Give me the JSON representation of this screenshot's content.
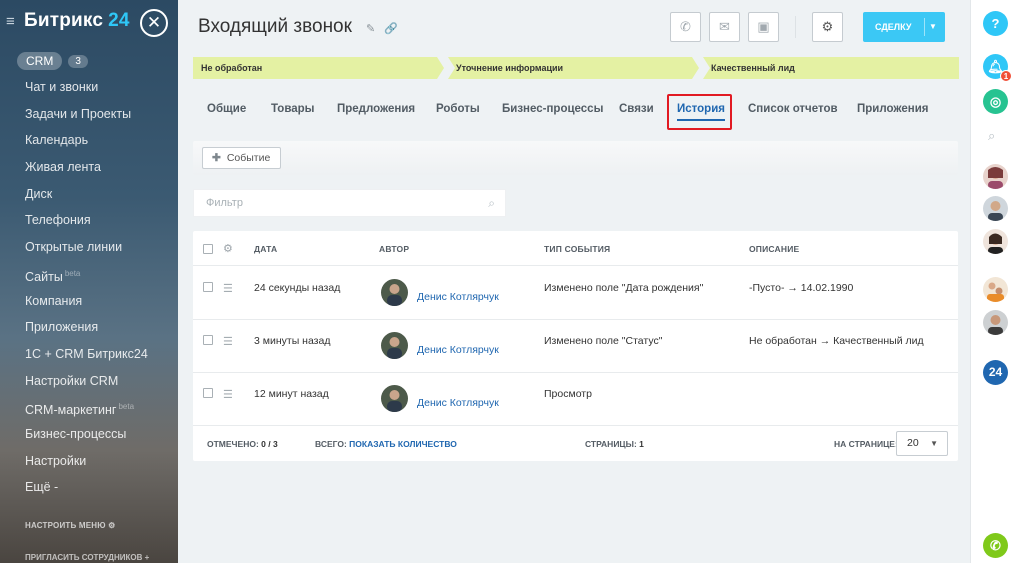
{
  "sidebar": {
    "logo_text": "Битрикс",
    "logo_num": "24",
    "crm_label": "CRM",
    "crm_count": "3",
    "items": [
      {
        "label": "Чат и звонки",
        "beta": ""
      },
      {
        "label": "Задачи и Проекты",
        "beta": ""
      },
      {
        "label": "Календарь",
        "beta": ""
      },
      {
        "label": "Живая лента",
        "beta": ""
      },
      {
        "label": "Диск",
        "beta": ""
      },
      {
        "label": "Телефония",
        "beta": ""
      },
      {
        "label": "Открытые линии",
        "beta": ""
      },
      {
        "label": "Сайты",
        "beta": "beta"
      },
      {
        "label": "Компания",
        "beta": ""
      },
      {
        "label": "Приложения",
        "beta": ""
      },
      {
        "label": "1С + CRM Битрикс24",
        "beta": ""
      },
      {
        "label": "Настройки CRM",
        "beta": ""
      },
      {
        "label": "CRM-маркетинг",
        "beta": "beta"
      },
      {
        "label": "Бизнес-процессы",
        "beta": ""
      },
      {
        "label": "Настройки",
        "beta": ""
      },
      {
        "label": "Ещё -",
        "beta": ""
      }
    ],
    "configure_menu": "НАСТРОИТЬ МЕНЮ",
    "invite": "ПРИГЛАСИТЬ СОТРУДНИКОВ"
  },
  "header": {
    "title": "Входящий звонок",
    "create_button": "СДЕЛКУ"
  },
  "stages": [
    "Не обработан",
    "Уточнение информации",
    "Качественный лид"
  ],
  "tabs": [
    "Общие",
    "Товары",
    "Предложения",
    "Роботы",
    "Бизнес-процессы",
    "Связи",
    "История",
    "Список отчетов",
    "Приложения"
  ],
  "active_tab": "История",
  "toolbar": {
    "event_button": "Событие"
  },
  "filter": {
    "placeholder": "Фильтр"
  },
  "grid": {
    "columns": [
      "ДАТА",
      "АВТОР",
      "ТИП СОБЫТИЯ",
      "ОПИСАНИЕ"
    ],
    "rows": [
      {
        "date": "24 секунды назад",
        "author": "Денис Котлярчук",
        "type": "Изменено поле \"Дата рождения\"",
        "description": "-Пусто- → 14.02.1990"
      },
      {
        "date": "3 минуты назад",
        "author": "Денис Котлярчук",
        "type": "Изменено поле \"Статус\"",
        "description": "Не обработан → Качественный лид"
      },
      {
        "date": "12 минут назад",
        "author": "Денис Котлярчук",
        "type": "Просмотр",
        "description": ""
      }
    ],
    "footer": {
      "marked_label": "ОТМЕЧЕНО:",
      "marked_value": "0 / 3",
      "total_label": "ВСЕГО:",
      "total_link": "ПОКАЗАТЬ КОЛИЧЕСТВО",
      "pages_label": "СТРАНИЦЫ:",
      "pages_value": "1",
      "per_page_label": "НА СТРАНИЦЕ:",
      "per_page_value": "20"
    }
  },
  "right_panel": {
    "help": "?",
    "notifications_count": "1",
    "b24": "24"
  },
  "colors": {
    "accent": "#3bc8f5",
    "link": "#2067b0",
    "stage": "#e4f1a3",
    "highlight": "#e11a22"
  }
}
